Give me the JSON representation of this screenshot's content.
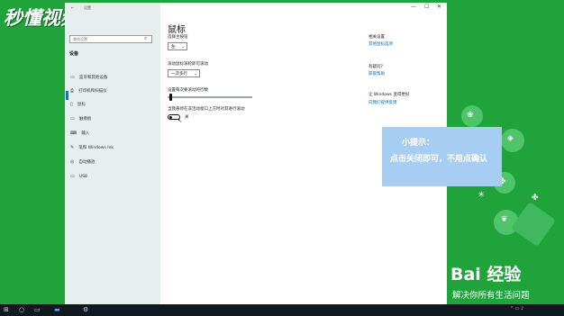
{
  "watermark": {
    "logo_text": "秒懂视频"
  },
  "window": {
    "title": "设置",
    "controls": {
      "minimize": "—",
      "maximize": "☐",
      "close": "✕"
    }
  },
  "sidebar": {
    "search_placeholder": "查找设置",
    "home_label": "设备",
    "items": [
      {
        "label": "蓝牙和其他设备",
        "icon": "bluetooth-icon"
      },
      {
        "label": "打印机和扫描仪",
        "icon": "printer-icon"
      },
      {
        "label": "鼠标",
        "icon": "mouse-icon"
      },
      {
        "label": "触摸板",
        "icon": "touchpad-icon"
      },
      {
        "label": "输入",
        "icon": "keyboard-icon"
      },
      {
        "label": "笔和 Windows Ink",
        "icon": "pen-icon"
      },
      {
        "label": "自动播放",
        "icon": "autoplay-icon"
      },
      {
        "label": "USB",
        "icon": "usb-icon"
      }
    ]
  },
  "main": {
    "title": "鼠标",
    "primary_button_label": "选择主按钮",
    "primary_button_value": "左",
    "scroll_label": "滚动鼠标滚轮即可滚动",
    "scroll_value": "一次多行",
    "lines_label": "设置每次要滚动的行数",
    "lines_fraction": 0.03,
    "inactive_scroll_label": "当我悬停在非活动窗口上方时对其进行滚动",
    "toggle_state": "关"
  },
  "related": {
    "heading": "相关设置",
    "link": "其他鼠标选项",
    "question_heading": "有疑问?",
    "help_link": "获取帮助",
    "better_heading": "让 Windows 变得更好",
    "feedback_link": "向我们提供反馈"
  },
  "tip": {
    "title": "小提示：",
    "body": "点击关闭即可，不用点确认"
  },
  "baidu": {
    "brand": "Bai 经验",
    "slogan": "解决你所有生活问题"
  },
  "taskbar": {
    "items": [
      "windows-logo-icon",
      "search-icon",
      "task-view-icon",
      "file-explorer-icon",
      "settings-icon"
    ]
  }
}
